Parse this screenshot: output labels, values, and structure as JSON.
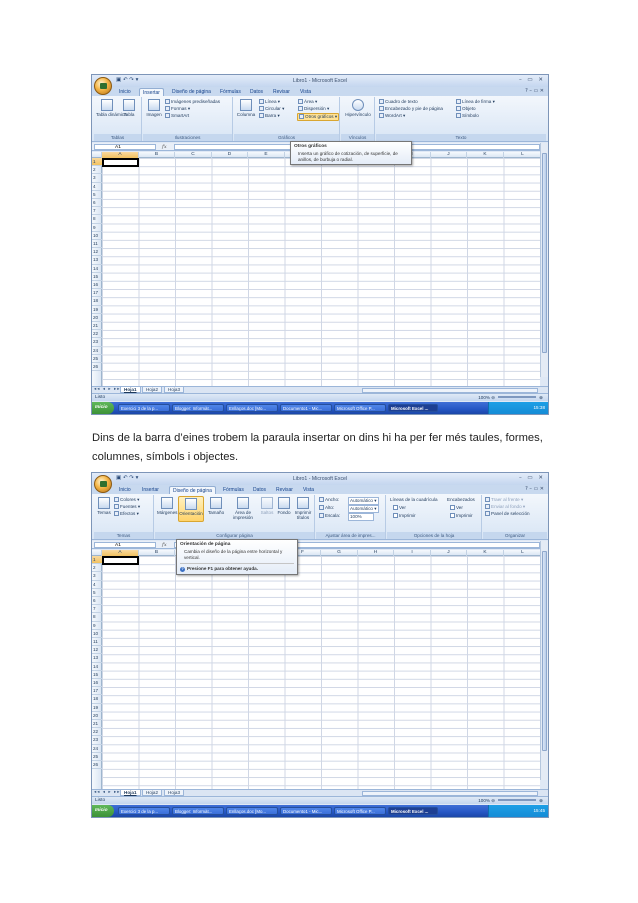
{
  "shot1": {
    "qat": "▣ ↶ ↷ ▾",
    "window_title": "Libro1 - Microsoft Excel",
    "window_buttons": "– ▭ ✕",
    "tabs": [
      "Inicio",
      "Insertar",
      "Diseño de página",
      "Fórmulas",
      "Datos",
      "Revisar",
      "Vista"
    ],
    "active_tab": "Insertar",
    "groups": [
      {
        "label": "Tablas",
        "buttons": [
          "Tabla dinámica",
          "Tabla"
        ]
      },
      {
        "label": "Ilustraciones",
        "buttons": [
          "Imagen"
        ],
        "rows": [
          "Imágenes prediseñadas",
          "Formas",
          "SmartArt"
        ]
      },
      {
        "label": "Gráficos",
        "buttons": [
          "Columna"
        ],
        "rows": [
          "Línea",
          "Área",
          "Circular",
          "Dispersión",
          "Barra",
          "Otros gráficos"
        ]
      },
      {
        "label": "Vínculos",
        "buttons": [
          "Hipervínculo"
        ]
      },
      {
        "label": "Texto",
        "rows": [
          "Cuadro de texto",
          "Línea de firma",
          "Encabezado y pie de página",
          "Objeto",
          "WordArt",
          "Símbolo"
        ]
      }
    ],
    "highlighted": "Otros gráficos",
    "tooltip": {
      "title": "Otros gráficos",
      "body": "Inserta un gráfico de cotización, de superficie, de anillos, de burbuja o radial."
    },
    "name_box": "A1",
    "fx": "fx",
    "columns": [
      "A",
      "B",
      "C",
      "D",
      "E",
      "F",
      "G",
      "H",
      "I",
      "J",
      "K",
      "L"
    ],
    "rows": [
      "1",
      "2",
      "3",
      "4",
      "5",
      "6",
      "7",
      "8",
      "9",
      "10",
      "11",
      "12",
      "13",
      "14",
      "15",
      "16",
      "17",
      "18",
      "19",
      "20",
      "21",
      "22",
      "23",
      "24",
      "25",
      "26"
    ],
    "sheets": [
      "Hoja1",
      "Hoja2",
      "Hoja3"
    ],
    "sheet_nav": "◂◂ ◂ ▸ ▸▸",
    "status": "Listo",
    "zoom": "100%",
    "taskbar": {
      "start": "Inicio",
      "tasks": [
        "Exercici 3 de la p...",
        "Blogger: Informàt...",
        "Enllaços.doc [Mo...",
        "Documento1 - Mic...",
        "Microsoft Office P...",
        "Microsoft Excel ..."
      ],
      "clock": "15:38"
    }
  },
  "caption": "Dins de la barra d’eines trobem la paraula insertar on dins hi ha per fer més taules, formes, columnes, símbols i objectes.",
  "shot2": {
    "qat": "▣ ↶ ↷ ▾",
    "window_title": "Libro1 - Microsoft Excel",
    "window_buttons": "– ▭ ✕",
    "tabs": [
      "Inicio",
      "Insertar",
      "Diseño de página",
      "Fórmulas",
      "Datos",
      "Revisar",
      "Vista"
    ],
    "active_tab": "Diseño de página",
    "groups": [
      {
        "label": "Temas",
        "buttons": [
          "Temas"
        ],
        "rows": [
          "Colores",
          "Fuentes",
          "Efectos"
        ]
      },
      {
        "label": "Configurar página",
        "buttons": [
          "Márgenes",
          "Orientación",
          "Tamaño",
          "Área de impresión",
          "Saltos",
          "Fondo",
          "Imprimir títulos"
        ]
      },
      {
        "label": "Ajustar área de impres...",
        "rows": [
          "Ancho:",
          "Automático",
          "Alto:",
          "Automático",
          "Escala:",
          "100%"
        ]
      },
      {
        "label": "Opciones de la hoja",
        "rows": [
          "Líneas de la cuadrícula",
          "Encabezados",
          "Ver",
          "Ver",
          "Imprimir",
          "Imprimir"
        ]
      },
      {
        "label": "Organizar",
        "rows": [
          "Traer al frente",
          "Enviar al fondo",
          "Panel de selección"
        ]
      }
    ],
    "highlighted": "Orientación",
    "tooltip": {
      "title": "Orientación de página",
      "body": "Cambia el diseño de la página entre horizontal y vertical.",
      "help": "Presione F1 para obtener ayuda."
    },
    "name_box": "A1",
    "fx": "fx",
    "columns": [
      "A",
      "B",
      "C",
      "D",
      "E",
      "F",
      "G",
      "H",
      "I",
      "J",
      "K",
      "L"
    ],
    "rows": [
      "1",
      "2",
      "3",
      "4",
      "5",
      "6",
      "7",
      "8",
      "9",
      "10",
      "11",
      "12",
      "13",
      "14",
      "15",
      "16",
      "17",
      "18",
      "19",
      "20",
      "21",
      "22",
      "23",
      "24",
      "25",
      "26"
    ],
    "sheets": [
      "Hoja1",
      "Hoja2",
      "Hoja3"
    ],
    "sheet_nav": "◂◂ ◂ ▸ ▸▸",
    "status": "Listo",
    "zoom": "100%",
    "taskbar": {
      "start": "Inicio",
      "tasks": [
        "Exercici 3 de la p...",
        "Blogger: Informàt...",
        "Enllaços.doc [Mo...",
        "Documento1 - Mic...",
        "Microsoft Office P...",
        "Microsoft Excel ..."
      ],
      "clock": "15:45"
    }
  }
}
